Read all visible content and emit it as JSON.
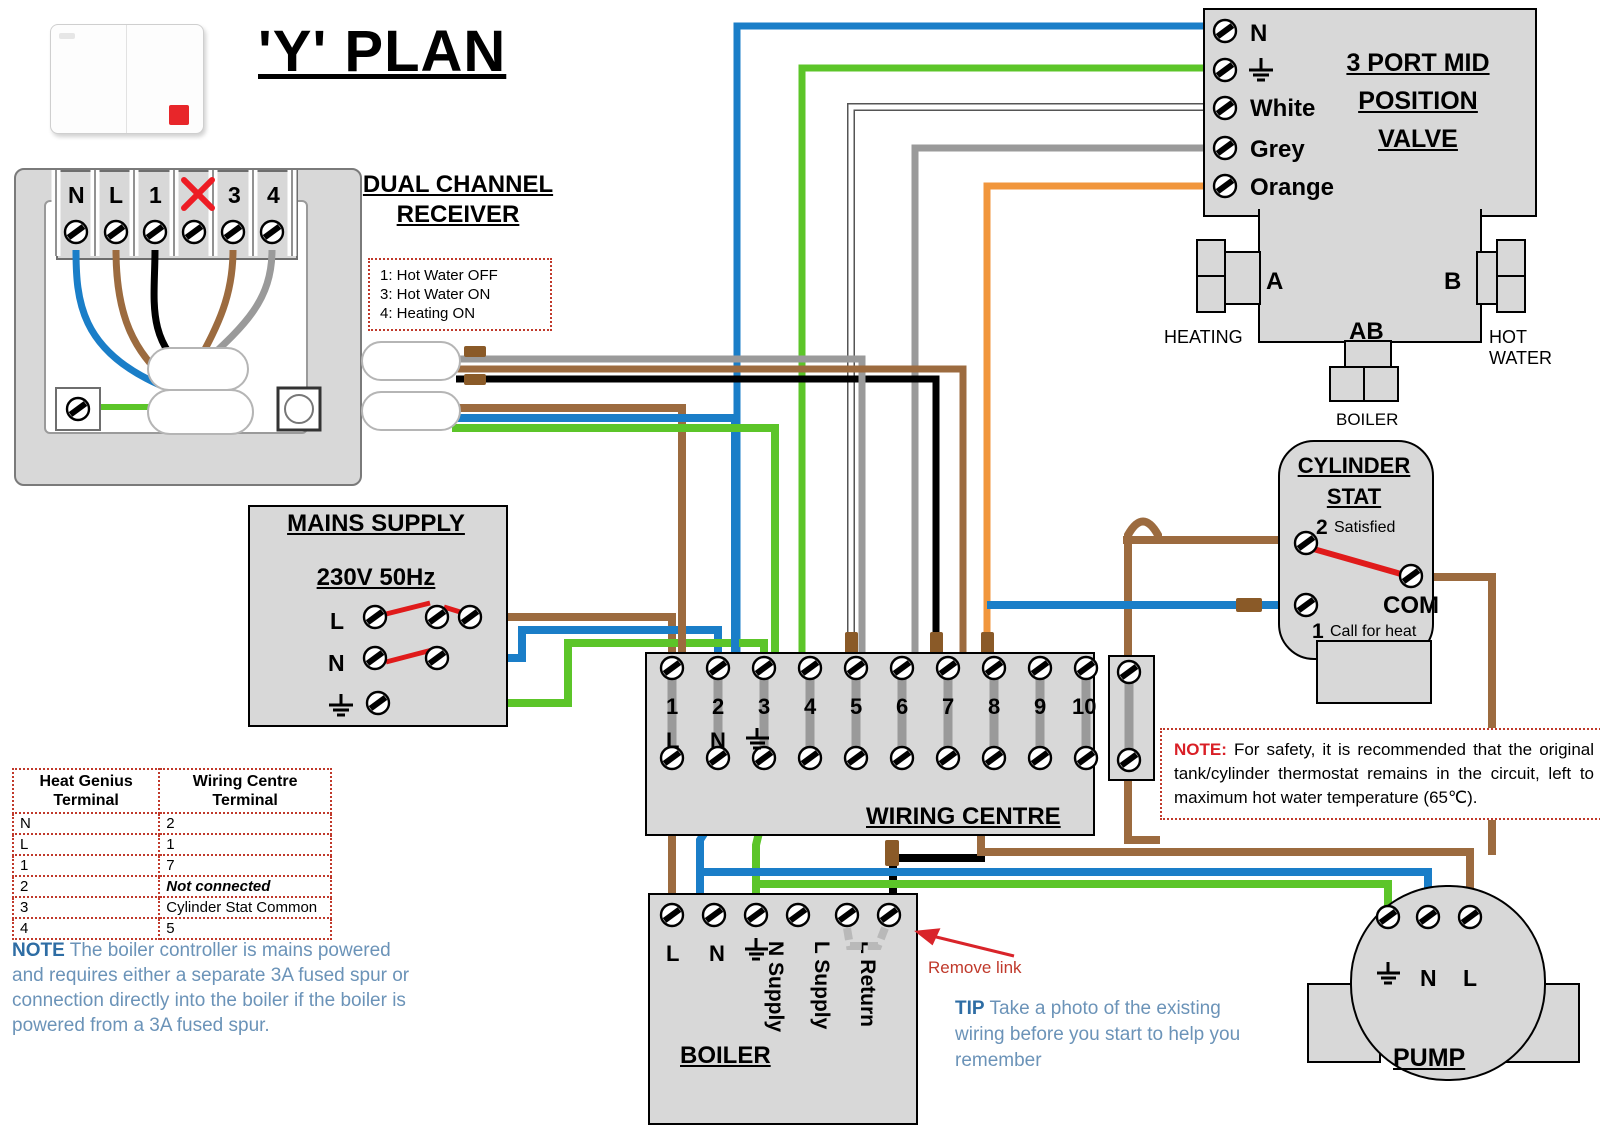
{
  "title": "'Y' PLAN",
  "receiver": {
    "heading_line1": "DUAL CHANNEL",
    "heading_line2": "RECEIVER",
    "terminals": [
      "N",
      "L",
      "1",
      "2",
      "3",
      "4"
    ],
    "crossed_terminal": "2",
    "legend": [
      "1: Hot Water OFF",
      "3: Hot Water ON",
      "4: Heating ON"
    ]
  },
  "mains": {
    "heading": "MAINS SUPPLY",
    "voltage": "230V 50Hz",
    "terminals": [
      "L",
      "N",
      "E"
    ]
  },
  "valve": {
    "heading_line1": "3 PORT MID",
    "heading_line2": "POSITION",
    "heading_line3": "VALVE",
    "terminals": [
      "N",
      "E",
      "White",
      "Grey",
      "Orange"
    ],
    "port_a": "A",
    "port_b": "B",
    "port_ab": "AB",
    "label_heating": "HEATING",
    "label_hot_water_line1": "HOT",
    "label_hot_water_line2": "WATER",
    "label_boiler": "BOILER"
  },
  "cylinder_stat": {
    "heading_line1": "CYLINDER",
    "heading_line2": "STAT",
    "t2_num": "2",
    "t2_label": "Satisfied",
    "t1_num": "1",
    "t1_label": "Call for heat",
    "com_label": "COM"
  },
  "wiring_centre": {
    "heading": "WIRING CENTRE",
    "numbers": [
      "1",
      "2",
      "3",
      "4",
      "5",
      "6",
      "7",
      "8",
      "9",
      "10"
    ],
    "sub_labels": [
      "L",
      "N",
      "E",
      "",
      "",
      "",
      "",
      "",
      "",
      ""
    ]
  },
  "boiler": {
    "heading": "BOILER",
    "terminals": [
      "L",
      "N",
      "E",
      "N Supply",
      "L Supply",
      "L Return"
    ],
    "remove_link": "Remove link"
  },
  "pump": {
    "heading": "PUMP",
    "terminals": [
      "E",
      "N",
      "L"
    ]
  },
  "mapping_table": {
    "header_left_line1": "Heat Genius",
    "header_left_line2": "Terminal",
    "header_right_line1": "Wiring Centre",
    "header_right_line2": "Terminal",
    "rows": [
      {
        "left": "N",
        "right": "2",
        "emph": false
      },
      {
        "left": "L",
        "right": "1",
        "emph": false
      },
      {
        "left": "1",
        "right": "7",
        "emph": false
      },
      {
        "left": "2",
        "right": "Not connected",
        "emph": true
      },
      {
        "left": "3",
        "right": "Cylinder Stat Common",
        "emph": false
      },
      {
        "left": "4",
        "right": "5",
        "emph": false
      }
    ]
  },
  "notes": {
    "note_left_bold": "NOTE",
    "note_left_body": " The boiler controller is mains powered and requires either a separate 3A fused spur or connection directly into the boiler if the boiler is powered from a 3A fused spur.",
    "note_right_bold": "NOTE:",
    "note_right_body": " For safety, it is recommended that the original tank/cylinder thermostat remains in the circuit, left to maximum hot water temperature (65℃).",
    "tip_bold": "TIP",
    "tip_body": " Take a photo of the existing wiring before you start to help you remember"
  },
  "colors": {
    "blue": "#1a7ec8",
    "brown": "#9c6b3f",
    "green": "#5cc529",
    "grey": "#9a9a9a",
    "orange": "#f1963c",
    "white": "#ffffff",
    "black": "#000000",
    "red": "#e01b1b",
    "panel": "#d8d8d8",
    "sleeve": "#8a5a28"
  }
}
